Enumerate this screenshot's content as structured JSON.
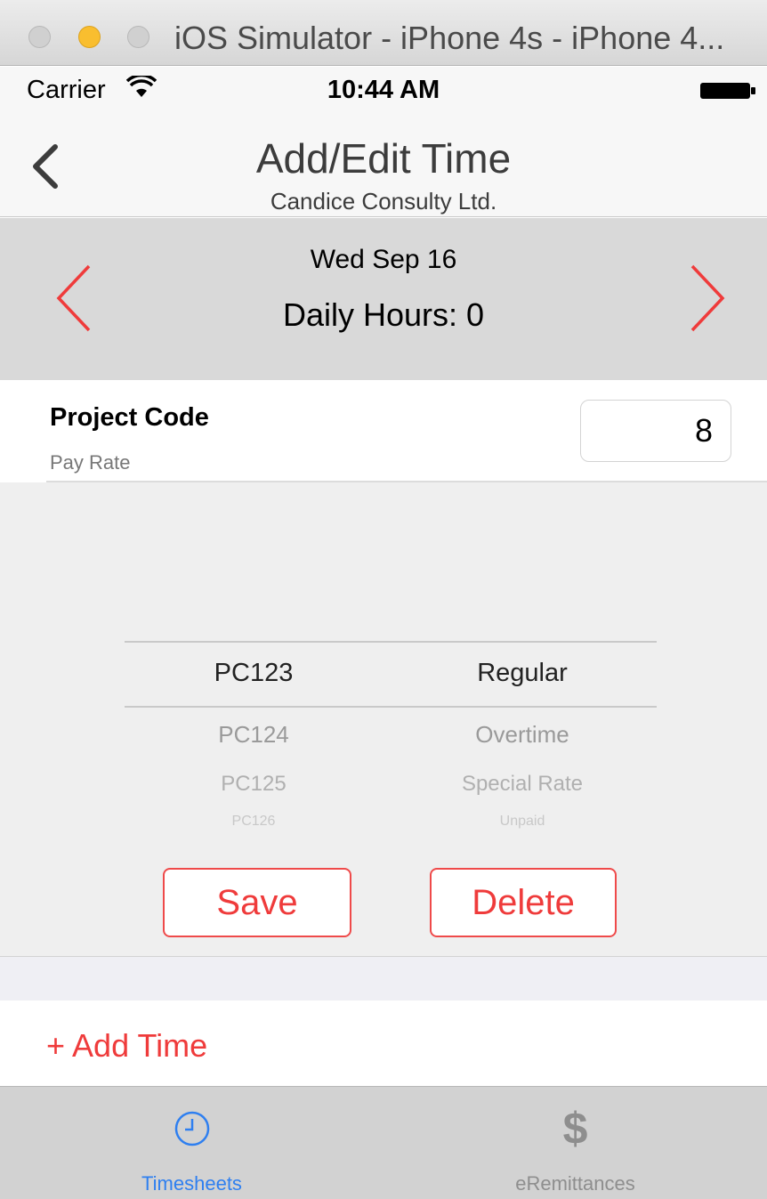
{
  "window": {
    "title": "iOS Simulator - iPhone 4s - iPhone 4..."
  },
  "status_bar": {
    "carrier": "Carrier",
    "time": "10:44 AM"
  },
  "nav": {
    "title": "Add/Edit Time",
    "subtitle": "Candice Consulty Ltd."
  },
  "date_banner": {
    "date": "Wed Sep 16",
    "daily_hours": "Daily Hours: 0"
  },
  "entry": {
    "project_label": "Project Code",
    "pay_rate_label": "Pay Rate",
    "hours_value": "8"
  },
  "picker": {
    "project_codes": [
      "PC123",
      "PC124",
      "PC125",
      "PC126"
    ],
    "pay_rates": [
      "Regular",
      "Overtime",
      "Special Rate",
      "Unpaid"
    ]
  },
  "actions": {
    "save_label": "Save",
    "delete_label": "Delete",
    "add_time_label": "+ Add Time"
  },
  "tabs": [
    {
      "label": "Timesheets",
      "icon": "clock-icon"
    },
    {
      "label": "eRemittances",
      "icon": "dollar-icon",
      "glyph": "$"
    }
  ],
  "colors": {
    "accent_red": "#ef3b3b",
    "tab_active": "#2e7ff0",
    "tab_inactive": "#8e8e8e"
  }
}
